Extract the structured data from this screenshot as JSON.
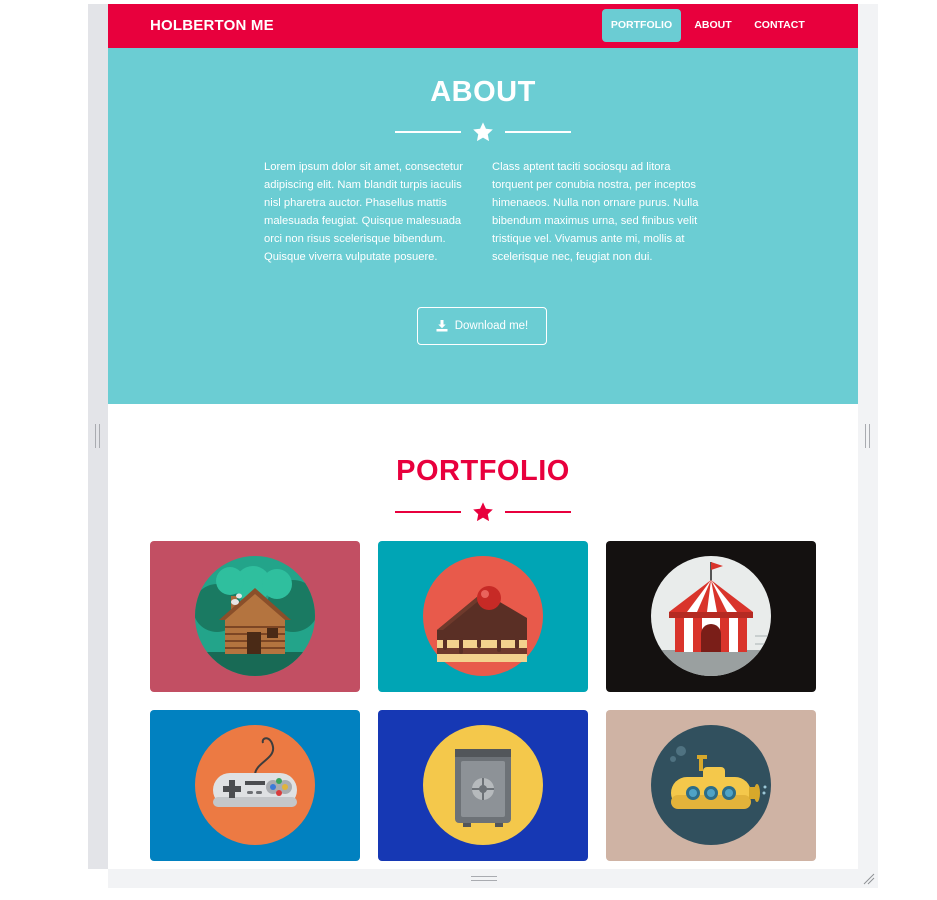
{
  "navbar": {
    "brand": "HOLBERTON ME",
    "items": [
      {
        "label": "PORTFOLIO",
        "active": true
      },
      {
        "label": "ABOUT",
        "active": false
      },
      {
        "label": "CONTACT",
        "active": false
      }
    ]
  },
  "about": {
    "title": "ABOUT",
    "column_1": "Lorem ipsum dolor sit amet, consectetur adipiscing elit. Nam blandit turpis iaculis nisl pharetra auctor. Phasellus mattis malesuada feugiat. Quisque malesuada orci non risus scelerisque bibendum. Quisque viverra vulputate posuere.",
    "column_2": "Class aptent taciti sociosqu ad litora torquent per conubia nostra, per inceptos himenaeos. Nulla non ornare purus. Nulla bibendum maximus urna, sed finibus velit tristique vel. Vivamus ante mi, mollis at scelerisque nec, feugiat non dui.",
    "download_label": "Download me!",
    "download_icon": "download-icon"
  },
  "portfolio": {
    "title": "PORTFOLIO",
    "tiles": [
      {
        "icon": "cabin-icon",
        "background": "#c24f63",
        "circle": "#23a48a"
      },
      {
        "icon": "cake-icon",
        "background": "#00a5b5",
        "circle": "#e85a4b"
      },
      {
        "icon": "circus-tent-icon",
        "background": "#141110",
        "circle": "#e9eceb"
      },
      {
        "icon": "game-controller-icon",
        "background": "#0181c0",
        "circle": "#ec7a43"
      },
      {
        "icon": "safe-icon",
        "background": "#1638b4",
        "circle": "#f4c84b"
      },
      {
        "icon": "submarine-icon",
        "background": "#cfb3a4",
        "circle": "#31505e"
      }
    ]
  },
  "colors": {
    "primary": "#e8003d",
    "accent": "#6bcdd3",
    "white": "#ffffff"
  }
}
